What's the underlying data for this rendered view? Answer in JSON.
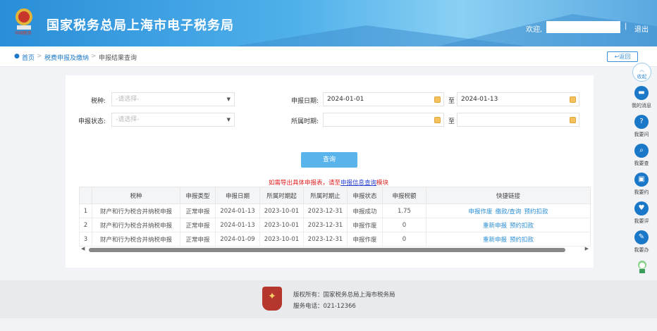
{
  "header": {
    "title": "国家税务总局上海市电子税务局",
    "welcome": "欢迎,",
    "separator": "|",
    "logout": "退出",
    "logo_text": "中国税务"
  },
  "breadcrumb": {
    "items": [
      "首页",
      "税费申报及缴纳",
      "申报结果查询"
    ],
    "sep": ">",
    "back": "返回"
  },
  "form": {
    "tax_type": {
      "label": "税种:",
      "placeholder": "-请选择-"
    },
    "status": {
      "label": "申报状态:",
      "placeholder": "-请选择-"
    },
    "report_date": {
      "label": "申报日期:",
      "from": "2024-01-01",
      "to": "2024-01-13",
      "to_label": "至"
    },
    "period": {
      "label": "所属时期:",
      "from": "",
      "to": "",
      "to_label": "至"
    },
    "query_button": "查询"
  },
  "notice": {
    "text": "如需导出具体申报表，请至",
    "link": "申报信息查询",
    "suffix": "模块"
  },
  "table": {
    "headers": [
      "",
      "税种",
      "申报类型",
      "申报日期",
      "所属时期起",
      "所属时期止",
      "申报状态",
      "申报税额",
      "快捷链接"
    ],
    "rows": [
      {
        "no": "1",
        "tax": "财产和行为税合并纳税申报",
        "type": "正常申报",
        "date": "2024-01-13",
        "start": "2023-10-01",
        "end": "2023-12-31",
        "status": "申报成功",
        "amount": "1.75",
        "links": [
          "申报作废",
          "缴款/查询",
          "预约扣款"
        ]
      },
      {
        "no": "2",
        "tax": "财产和行为税合并纳税申报",
        "type": "正常申报",
        "date": "2024-01-13",
        "start": "2023-10-01",
        "end": "2023-12-31",
        "status": "申报作废",
        "amount": "0",
        "links": [
          "重新申报",
          "预约扣款"
        ]
      },
      {
        "no": "3",
        "tax": "财产和行为税合并纳税申报",
        "type": "正常申报",
        "date": "2024-01-09",
        "start": "2023-10-01",
        "end": "2023-12-31",
        "status": "申报作废",
        "amount": "0",
        "links": [
          "重新申报",
          "预约扣款"
        ]
      }
    ]
  },
  "sidebar": {
    "collapse": "收起",
    "items": [
      {
        "label": "我的消息",
        "icon": "message-icon",
        "glyph": "▬"
      },
      {
        "label": "我要问",
        "icon": "question-icon",
        "glyph": "?"
      },
      {
        "label": "我要查",
        "icon": "search-icon",
        "glyph": "⌕"
      },
      {
        "label": "我要约",
        "icon": "calendar-icon",
        "glyph": "▣"
      },
      {
        "label": "我要评",
        "icon": "rate-icon",
        "glyph": "♥"
      },
      {
        "label": "我要办",
        "icon": "edit-icon",
        "glyph": "✎"
      }
    ]
  },
  "footer": {
    "copyright": "版权所有：国家税务总局上海市税务局",
    "phone": "服务电话：021-12366"
  }
}
